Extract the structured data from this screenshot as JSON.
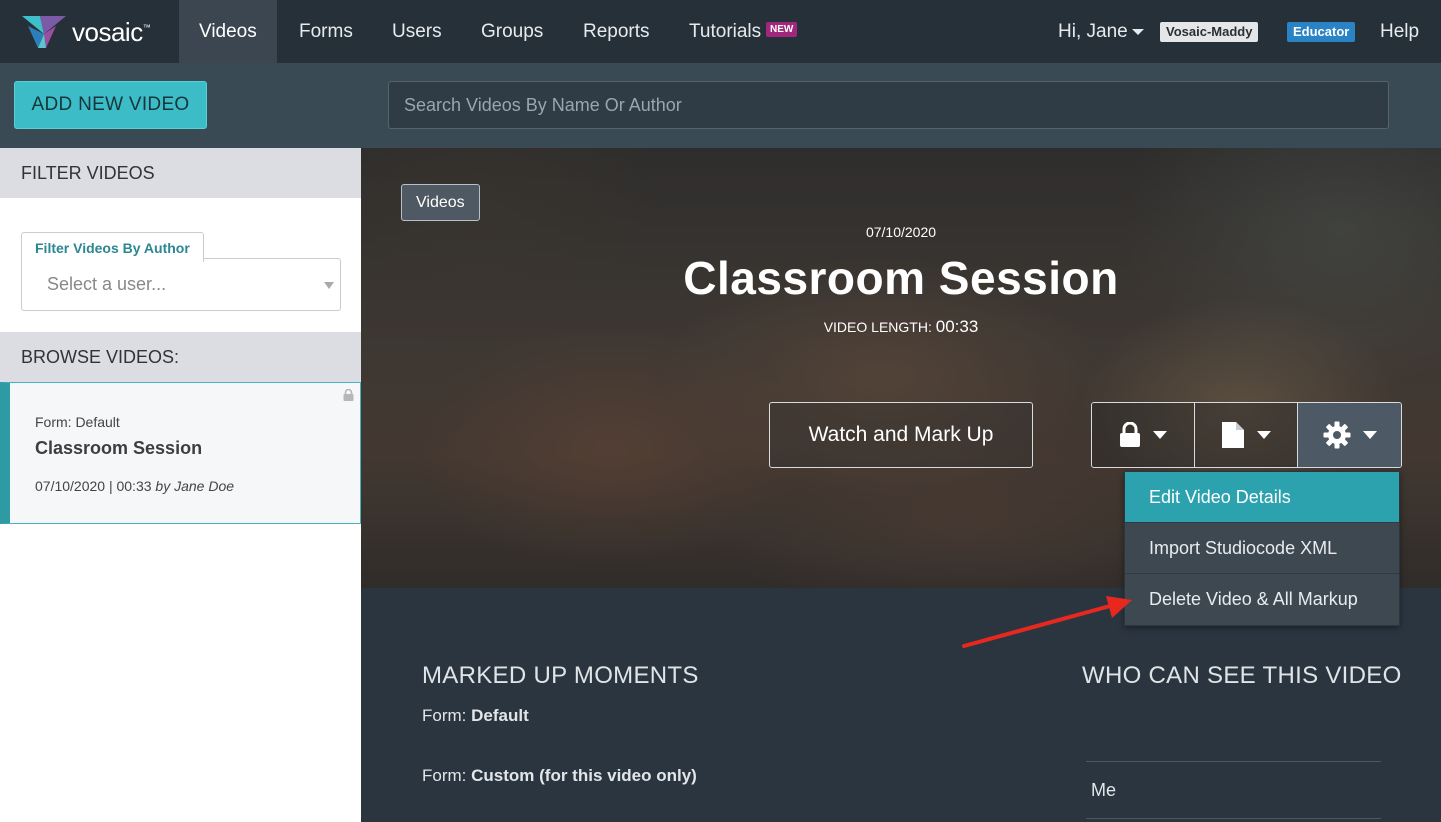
{
  "brand": {
    "name": "vosaic",
    "tm": "™"
  },
  "nav": {
    "items": [
      {
        "label": "Videos",
        "active": true
      },
      {
        "label": "Forms"
      },
      {
        "label": "Users"
      },
      {
        "label": "Groups"
      },
      {
        "label": "Reports"
      },
      {
        "label": "Tutorials",
        "badge": "NEW"
      }
    ],
    "greeting": "Hi, Jane",
    "org": "Vosaic-Maddy",
    "role": "Educator",
    "help": "Help"
  },
  "toolbar": {
    "add_label": "ADD NEW VIDEO",
    "search_placeholder": "Search Videos By Name Or Author"
  },
  "sidebar": {
    "filter_heading": "FILTER VIDEOS",
    "filter_tab": "Filter Videos By Author",
    "filter_placeholder": "Select a user...",
    "browse_heading": "BROWSE VIDEOS:",
    "videos": [
      {
        "form": "Form: Default",
        "title": "Classroom Session",
        "meta": "07/10/2020 | 00:33",
        "author": "by Jane Doe"
      }
    ]
  },
  "hero": {
    "breadcrumb": "Videos",
    "date": "07/10/2020",
    "title": "Classroom Session",
    "length_label": "VIDEO LENGTH:",
    "length_value": "00:33",
    "watch_label": "Watch and Mark Up"
  },
  "settings_menu": {
    "items": [
      {
        "label": "Edit Video Details",
        "active": true
      },
      {
        "label": "Import Studiocode XML"
      },
      {
        "label": "Delete Video & All Markup"
      }
    ]
  },
  "lower": {
    "moments_heading": "MARKED UP MOMENTS",
    "form_prefix": "Form:",
    "forms": [
      "Default",
      "Custom (for this video only)"
    ],
    "visibility_heading": "WHO CAN SEE THIS VIDEO",
    "visibility": [
      "Me"
    ]
  },
  "colors": {
    "accent": "#3bbcc7",
    "active_menu": "#2ba2ae",
    "nav_bg": "#263039",
    "role_badge": "#2a83c4",
    "new_badge": "#a0277b",
    "annotation_arrow": "#e8281e"
  }
}
